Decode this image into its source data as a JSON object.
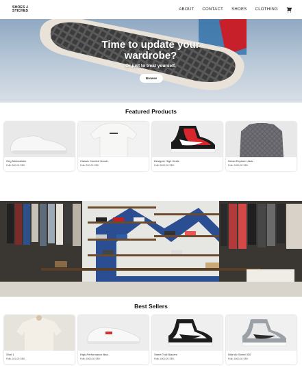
{
  "brand": {
    "line1": "SHOES",
    "amp": "&",
    "line2": "STICHES"
  },
  "nav": {
    "items": [
      "ABOUT",
      "CONTACT",
      "SHOES",
      "CLOTHING"
    ],
    "cart_icon": "cart-icon"
  },
  "hero": {
    "title": "Time to update your wardrobe?",
    "subtitle": "Or just to treat yourself.",
    "button": "Browse"
  },
  "featured": {
    "title": "Featured Products",
    "products": [
      {
        "name": "Orig Minimalistic",
        "price": "Från 500,00 SEK"
      },
      {
        "name": "Classic Comfort Hoodi..",
        "price": "Från 220,00 SEK"
      },
      {
        "name": "Designer High Heels",
        "price": "Från 5000,00 SEK"
      },
      {
        "name": "Urban Explorer Jack..",
        "price": "Från 1990,00 SEK"
      }
    ]
  },
  "bestsellers": {
    "title": "Best Sellers",
    "products": [
      {
        "name": "Shirt 1",
        "price": "Från 101,00 SEK"
      },
      {
        "name": "High-Performance Bas..",
        "price": "Från 1500,00 SEK"
      },
      {
        "name": "Street Trail Blazers",
        "price": "Från 1000,00 SEK"
      },
      {
        "name": "Nike Air Street 330",
        "price": "Från 1500,00 SEK"
      }
    ]
  }
}
